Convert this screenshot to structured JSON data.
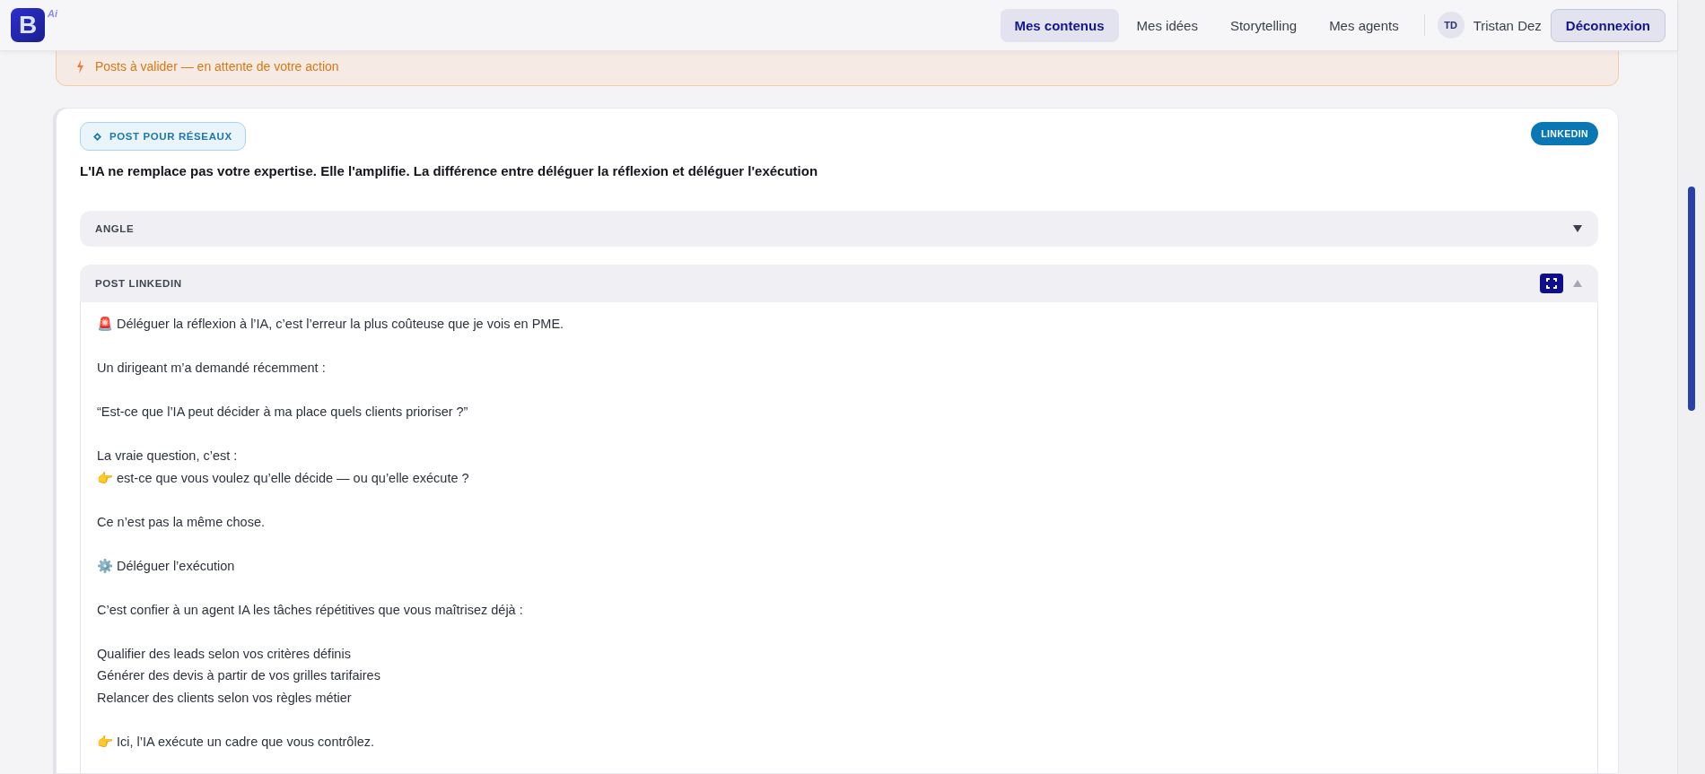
{
  "header": {
    "logo": {
      "letter": "B",
      "badge": "Ai"
    },
    "nav": [
      {
        "label": "Mes contenus",
        "selected": true
      },
      {
        "label": "Mes idées",
        "selected": false
      },
      {
        "label": "Storytelling",
        "selected": false
      },
      {
        "label": "Mes agents",
        "selected": false
      }
    ],
    "user": {
      "initials": "TD",
      "name": "Tristan Dez"
    },
    "logout": "Déconnexion"
  },
  "banner": {
    "text": "Posts à valider — en attente de votre action"
  },
  "post": {
    "type_chip": "POST POUR RÉSEAUX",
    "platform": "LINKEDIN",
    "title": "L'IA ne remplace pas votre expertise. Elle l'amplifie. La différence entre déléguer la réflexion et déléguer l'exécution",
    "sections": [
      {
        "label": "ANGLE",
        "expanded": false
      },
      {
        "label": "POST LINKEDIN",
        "expanded": true,
        "paragraphs": [
          [
            "🚨 Déléguer la réflexion à l’IA, c’est l’erreur la plus coûteuse que je vois en PME."
          ],
          [
            "Un dirigeant m’a demandé récemment :"
          ],
          [
            "“Est-ce que l’IA peut décider à ma place quels clients prioriser ?”"
          ],
          [
            "La vraie question, c’est :",
            "👉 est-ce que vous voulez qu’elle décide — ou qu’elle exécute ?"
          ],
          [
            "Ce n’est pas la même chose."
          ],
          [
            "⚙️ Déléguer l’exécution"
          ],
          [
            "C’est confier à un agent IA les tâches répétitives que vous maîtrisez déjà :"
          ],
          [
            "Qualifier des leads selon vos critères définis",
            "Générer des devis à partir de vos grilles tarifaires",
            "Relancer des clients selon vos règles métier"
          ],
          [
            "👉 Ici, l’IA exécute un cadre que vous contrôlez."
          ]
        ]
      }
    ]
  }
}
